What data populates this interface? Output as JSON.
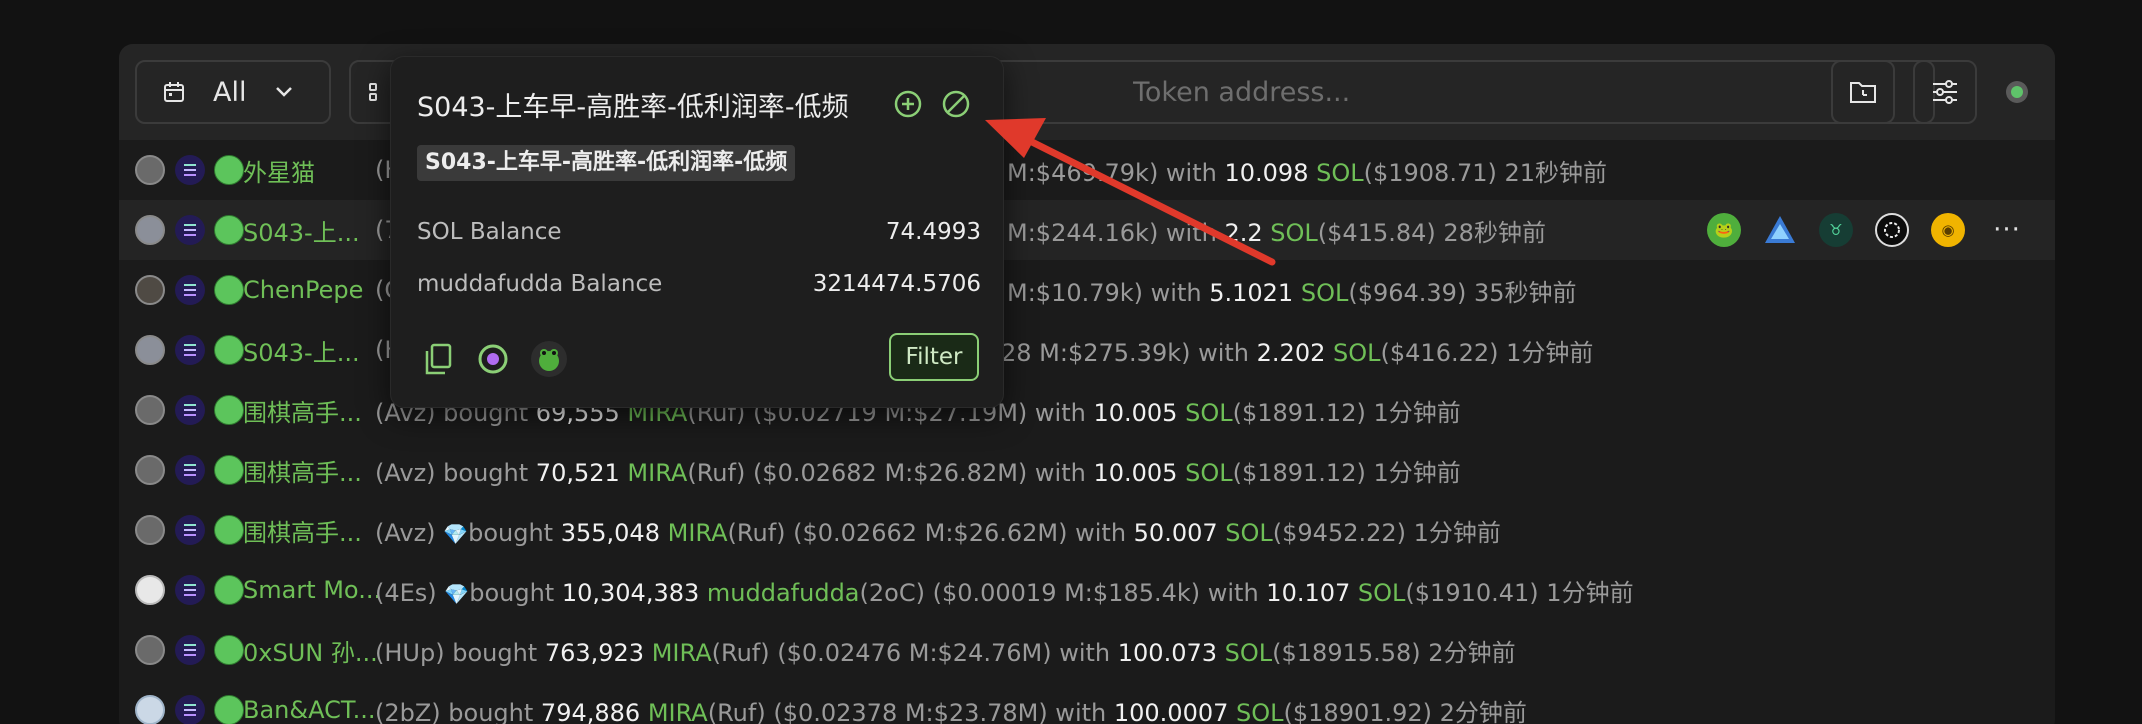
{
  "toolbar": {
    "range_label": "All",
    "token_placeholder": "Token address..."
  },
  "rows": [
    {
      "name": "外星猫",
      "line_prefix": "(H",
      "mid": "M:$469.79k) with ",
      "sol_amt": "10.098",
      "sol": "SOL",
      "usd": "($1908.71)",
      "time": " 21秒钟前"
    },
    {
      "name": "S043-上...",
      "line_prefix": "(7",
      "mid": "M:$244.16k) with ",
      "sol_amt": "2.2",
      "sol": "SOL",
      "usd": "($415.84)",
      "time": " 28秒钟前"
    },
    {
      "name": "ChenPepe",
      "line_prefix": "(C",
      "mid": "M:$10.79k) with ",
      "sol_amt": "5.1021",
      "sol": "SOL",
      "usd": "($964.39)",
      "time": " 35秒钟前"
    },
    {
      "name": "S043-上...",
      "line_prefix": "(H",
      "mid": "28 M:$275.39k) with ",
      "sol_amt": "2.202",
      "sol": "SOL",
      "usd": "($416.22)",
      "time": " 1分钟前"
    },
    {
      "name": "围棋高手...",
      "addr": "(Avz)",
      "action": " bought ",
      "amount": "69,555",
      "token": "MIRA",
      "token_addr": "(Ruf)",
      "price": " ($0.02719 M:$27.19M) with ",
      "sol_amt": "10.005",
      "sol": "SOL",
      "usd": "($1891.12)",
      "time": " 1分钟前"
    },
    {
      "name": "围棋高手...",
      "addr": "(Avz)",
      "action": " bought ",
      "amount": "70,521",
      "token": "MIRA",
      "token_addr": "(Ruf)",
      "price": " ($0.02682 M:$26.82M) with ",
      "sol_amt": "10.005",
      "sol": "SOL",
      "usd": "($1891.12)",
      "time": " 1分钟前"
    },
    {
      "name": "围棋高手...",
      "addr": "(Avz)",
      "action": "bought ",
      "amount": "355,048",
      "token": "MIRA",
      "token_addr": "(Ruf)",
      "price": " ($0.02662 M:$26.62M) with ",
      "sol_amt": "50.007",
      "sol": "SOL",
      "usd": "($9452.22)",
      "time": " 1分钟前"
    },
    {
      "name": "Smart Mo...",
      "addr": "(4Es)",
      "action": "bought ",
      "amount": "10,304,383",
      "token": "muddafudda",
      "token_addr": "(2oC)",
      "price": " ($0.00019 M:$185.4k) with ",
      "sol_amt": "10.107",
      "sol": "SOL",
      "usd": "($1910.41)",
      "time": " 1分钟前"
    },
    {
      "name": "0xSUN 孙...",
      "addr": "(HUp)",
      "action": " bought ",
      "amount": "763,923",
      "token": "MIRA",
      "token_addr": "(Ruf)",
      "price": " ($0.02476 M:$24.76M) with ",
      "sol_amt": "100.073",
      "sol": "SOL",
      "usd": "($18915.58)",
      "time": " 2分钟前"
    },
    {
      "name": "Ban&ACT...",
      "addr": "(2bZ)",
      "action": " bought ",
      "amount": "794,886",
      "token": "MIRA",
      "token_addr": "(Ruf)",
      "price": " ($0.02378 M:$23.78M) with ",
      "sol_amt": "100.0007",
      "sol": "SOL",
      "usd": "($18901.92)",
      "time": " 2分钟前"
    }
  ],
  "popover": {
    "title": "S043-上车早-高胜率-低利润率-低频",
    "tag": "S043-上车早-高胜率-低利润率-低频",
    "sol_balance_label": "SOL Balance",
    "sol_balance_value": "74.4993",
    "token_balance_label": "muddafudda Balance",
    "token_balance_value": "3214474.5706",
    "filter_label": "Filter"
  },
  "colors": {
    "accent_green": "#6fbf57",
    "annotation_arrow": "#e0392b"
  }
}
